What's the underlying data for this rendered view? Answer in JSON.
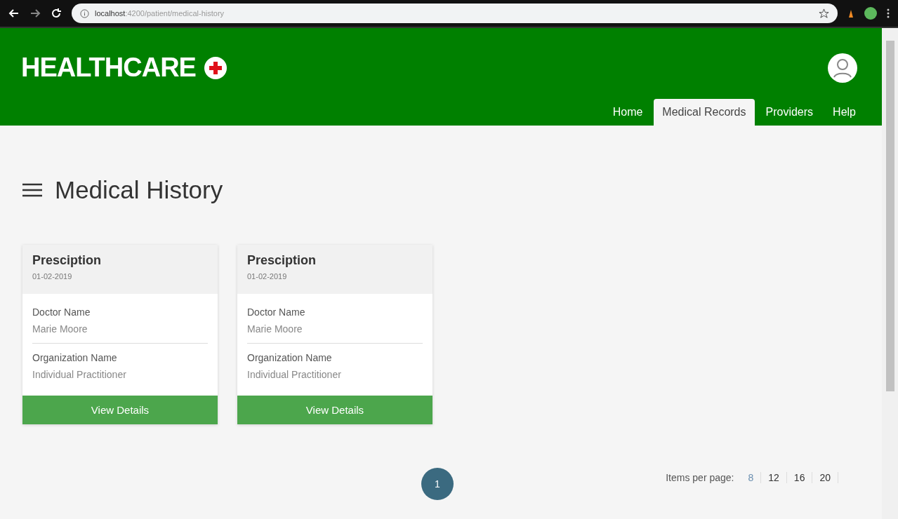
{
  "browser": {
    "url_host": "localhost",
    "url_path": ":4200/patient/medical-history"
  },
  "header": {
    "logo": "HEALTHCARE",
    "nav": [
      {
        "label": "Home",
        "selected": false
      },
      {
        "label": "Medical Records",
        "selected": true
      },
      {
        "label": "Providers",
        "selected": false
      },
      {
        "label": "Help",
        "selected": false
      }
    ]
  },
  "page": {
    "title": "Medical History"
  },
  "cards": [
    {
      "title": "Presciption",
      "date": "01-02-2019",
      "fields": [
        {
          "label": "Doctor Name",
          "value": "Marie Moore"
        },
        {
          "label": "Organization Name",
          "value": "Individual Practitioner"
        }
      ],
      "button": "View Details"
    },
    {
      "title": "Presciption",
      "date": "01-02-2019",
      "fields": [
        {
          "label": "Doctor Name",
          "value": "Marie Moore"
        },
        {
          "label": "Organization Name",
          "value": "Individual Practitioner"
        }
      ],
      "button": "View Details"
    }
  ],
  "pagination": {
    "pages": [
      {
        "label": "1",
        "selected": true
      }
    ],
    "items_per_page_label": "Items per page:",
    "sizes": [
      {
        "label": "8",
        "selected": true
      },
      {
        "label": "12",
        "selected": false
      },
      {
        "label": "16",
        "selected": false
      },
      {
        "label": "20",
        "selected": false
      }
    ]
  }
}
